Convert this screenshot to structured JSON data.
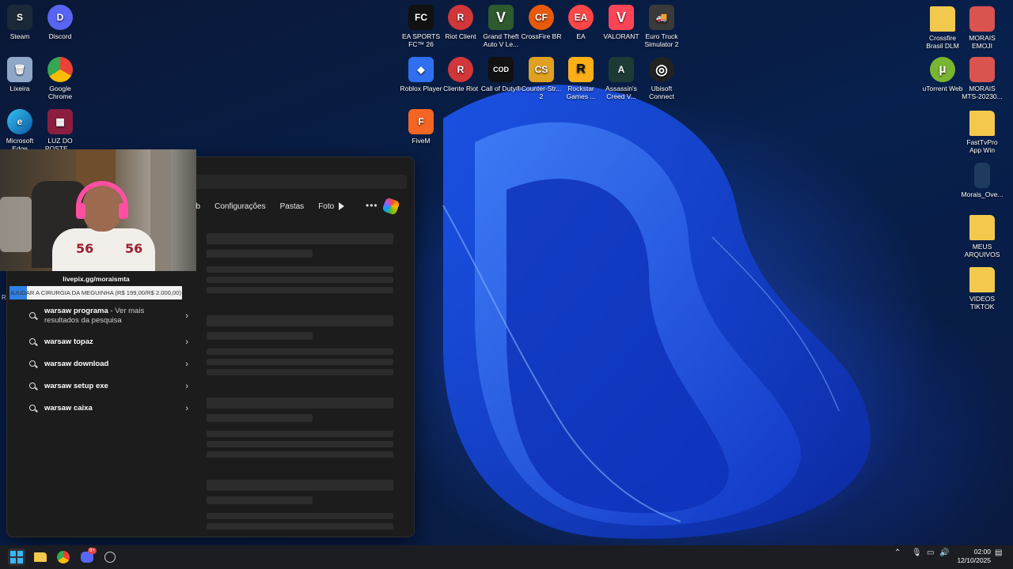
{
  "desktop": {
    "icons_left": [
      {
        "name": "steam",
        "label": "Steam",
        "color": "#1b2838",
        "glyph": "S"
      },
      {
        "name": "discord",
        "label": "Discord",
        "color": "#5865f2",
        "glyph": "D"
      },
      {
        "name": "recycle-bin",
        "label": "Lixeira",
        "color": "#8fa8c8",
        "glyph": "🗑"
      },
      {
        "name": "google-chrome",
        "label": "Google Chrome",
        "color": "#4285f4",
        "glyph": "◉"
      },
      {
        "name": "microsoft-edge",
        "label": "Microsoft Edge",
        "color": "#0f7bd1",
        "glyph": "e"
      },
      {
        "name": "luz-do-poste",
        "label": "LUZ DO POSTE ...",
        "color": "#8b1e3f",
        "glyph": "▦"
      }
    ],
    "icons_top": [
      {
        "name": "ea-sports-fc",
        "label": "EA SPORTS FC™ 26",
        "color": "#111111",
        "glyph": "FC"
      },
      {
        "name": "riot-client",
        "label": "Riot Client",
        "color": "#d13639",
        "glyph": "R"
      },
      {
        "name": "gta-v",
        "label": "Grand Theft Auto V Le...",
        "color": "#2e5a2e",
        "glyph": "V"
      },
      {
        "name": "crossfire-br",
        "label": "CrossFire BR",
        "color": "#e8590c",
        "glyph": "CF"
      },
      {
        "name": "ea",
        "label": "EA",
        "color": "#ff4747",
        "glyph": "EA"
      },
      {
        "name": "valorant",
        "label": "VALORANT",
        "color": "#fd4556",
        "glyph": "V"
      },
      {
        "name": "euro-truck",
        "label": "Euro Truck Simulator 2",
        "color": "#3a3a3a",
        "glyph": "🚚"
      },
      {
        "name": "roblox-player",
        "label": "Roblox Player",
        "color": "#2f6ff0",
        "glyph": "◆"
      },
      {
        "name": "cliente-riot",
        "label": "Cliente Riot",
        "color": "#d13639",
        "glyph": "R"
      },
      {
        "name": "call-of-duty",
        "label": "Call of Duty®",
        "color": "#111111",
        "glyph": "COD"
      },
      {
        "name": "counter-strike",
        "label": "Counter-Str... 2",
        "color": "#e0a020",
        "glyph": "CS"
      },
      {
        "name": "rockstar-games",
        "label": "Rockstar Games ...",
        "color": "#fcaf17",
        "glyph": "R"
      },
      {
        "name": "assassins-creed",
        "label": "Assassin's Creed V...",
        "color": "#1d3b34",
        "glyph": "A"
      },
      {
        "name": "ubisoft-connect",
        "label": "Ubisoft Connect",
        "color": "#222222",
        "glyph": "◎"
      },
      {
        "name": "fivem",
        "label": "FiveM",
        "color": "#f26522",
        "glyph": "F"
      }
    ],
    "icons_right": [
      {
        "name": "crossfire-brasil-dlm",
        "label": "Crossfire Brasil DLM",
        "color": "#f2c94c",
        "glyph": ""
      },
      {
        "name": "morais-emoji",
        "label": "MORAIS EMOJI",
        "color": "#d9534f",
        "glyph": ""
      },
      {
        "name": "utorrent-web",
        "label": "uTorrent Web",
        "color": "#79b530",
        "glyph": "µ"
      },
      {
        "name": "morais-mts",
        "label": "MORAIS MTS-20230...",
        "color": "#d9534f",
        "glyph": ""
      },
      {
        "name": "fasttvpro",
        "label": "FastTvPro App Win",
        "color": "#f2c94c",
        "glyph": ""
      },
      {
        "name": "morais-ove",
        "label": "Morais_Ove...",
        "color": "#1f3a5f",
        "glyph": ""
      },
      {
        "name": "meus-arquivos",
        "label": "MEUS ARQUIVOS",
        "color": "#f2c94c",
        "glyph": ""
      },
      {
        "name": "videos-tiktok",
        "label": "VIDEOS TIKTOK",
        "color": "#f2c94c",
        "glyph": ""
      }
    ]
  },
  "search": {
    "tabs": [
      "eb",
      "Configurações",
      "Pastas",
      "Foto"
    ],
    "suggestions": [
      {
        "bold": "warsaw programa",
        "rest": " - Ver mais resultados da pesquisa"
      },
      {
        "bold": "warsaw topaz",
        "rest": ""
      },
      {
        "bold": "warsaw download",
        "rest": ""
      },
      {
        "bold": "warsaw setup exe",
        "rest": ""
      },
      {
        "bold": "warsaw caixa",
        "rest": ""
      }
    ]
  },
  "overlay": {
    "livepix": "livepix.gg/moraismta",
    "donation_text": "AJUDAR A CIRURGIA DA MEGUINHA (R$ 199,00/R$ 2.000,00)",
    "donation_progress": 0.0995,
    "shirt_number": "56",
    "partial_letter": "R"
  },
  "taskbar": {
    "discord_badge": "9+",
    "time": "02:00",
    "date": "12/10/2025"
  },
  "colors": {
    "accent": "#38b6ff",
    "panel_bg": "#1c1c1c",
    "progress": "#2f7fe6"
  }
}
